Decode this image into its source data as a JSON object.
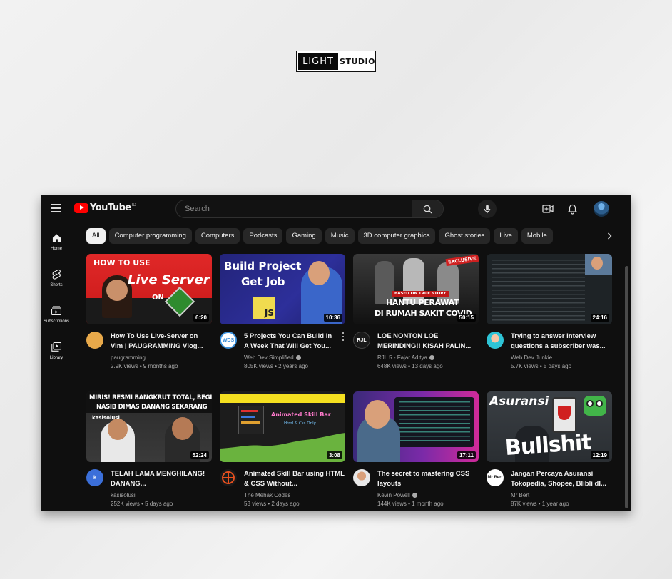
{
  "watermark": {
    "left": "LIGHT",
    "right": "STUDIO"
  },
  "header": {
    "logo_text": "YouTube",
    "country_code": "ID",
    "search_placeholder": "Search"
  },
  "sidebar": [
    {
      "label": "Home",
      "icon": "home-icon"
    },
    {
      "label": "Shorts",
      "icon": "shorts-icon"
    },
    {
      "label": "Subscriptions",
      "icon": "subscriptions-icon"
    },
    {
      "label": "Library",
      "icon": "library-icon"
    }
  ],
  "chips": [
    "All",
    "Computer programming",
    "Computers",
    "Podcasts",
    "Gaming",
    "Music",
    "3D computer graphics",
    "Ghost stories",
    "Live",
    "Mobile"
  ],
  "thumb_text": {
    "v0_a": "HOW TO USE",
    "v0_b": "Live Server",
    "v0_c": "ON",
    "v1_a": "Build Project",
    "v1_b": "Get Job",
    "v1_js": "JS",
    "v2_a": "EXCLUSIVE",
    "v2_b": "BASED ON TRUE STORY",
    "v2_c": "HANTU PERAWAT",
    "v2_d": "DI RUMAH SAKIT COVID",
    "v4_a": "MIRIS! RESMI BANGKRUT TOTAL, BEGINI",
    "v4_b": "NASIB DIMAS DANANG SEKARANG",
    "v4_c": "kasisolusi",
    "v5_a": "Animated Skill Bar",
    "v5_b": "Html & Css Only",
    "v7_a": "Asuransi",
    "v7_b": "Bullshit"
  },
  "videos": [
    {
      "title": "How To Use Live-Server on Vim | PAUGRAMMING Vlog...",
      "channel": "paugramming",
      "verified": false,
      "stats": "2.9K views • 9 months ago",
      "duration": "6:20"
    },
    {
      "title": "5 Projects You Can Build In A Week That Will Get You...",
      "channel": "Web Dev Simplified",
      "verified": true,
      "stats": "805K views • 2 years ago",
      "duration": "10:36"
    },
    {
      "title": "LOE NONTON LOE MERINDING!! KISAH PALIN...",
      "channel": "RJL 5 - Fajar Aditya",
      "verified": true,
      "stats": "648K views • 13 days ago",
      "duration": "50:15"
    },
    {
      "title": "Trying to answer interview questions a subscriber was...",
      "channel": "Web Dev Junkie",
      "verified": false,
      "stats": "5.7K views • 5 days ago",
      "duration": "24:16"
    },
    {
      "title": "TELAH LAMA MENGHILANG! DANANG...",
      "channel": "kasisolusi",
      "verified": false,
      "stats": "252K views • 5 days ago",
      "duration": "52:24"
    },
    {
      "title": "Animated Skill Bar using HTML & CSS Without...",
      "channel": "The Mehak Codes",
      "verified": false,
      "stats": "53 views • 2 days ago",
      "duration": "3:08"
    },
    {
      "title": "The secret to mastering CSS layouts",
      "channel": "Kevin Powell",
      "verified": true,
      "stats": "144K views • 1 month ago",
      "duration": "17:11"
    },
    {
      "title": "Jangan Percaya Asuransi Tokopedia, Shopee, Blibli dl...",
      "channel": "Mr Bert",
      "verified": false,
      "stats": "87K views • 1 year ago",
      "duration": "12:19"
    }
  ],
  "colors": {
    "background": "#0f0f0f",
    "chip": "#272727",
    "accent_red": "#ff0000"
  }
}
